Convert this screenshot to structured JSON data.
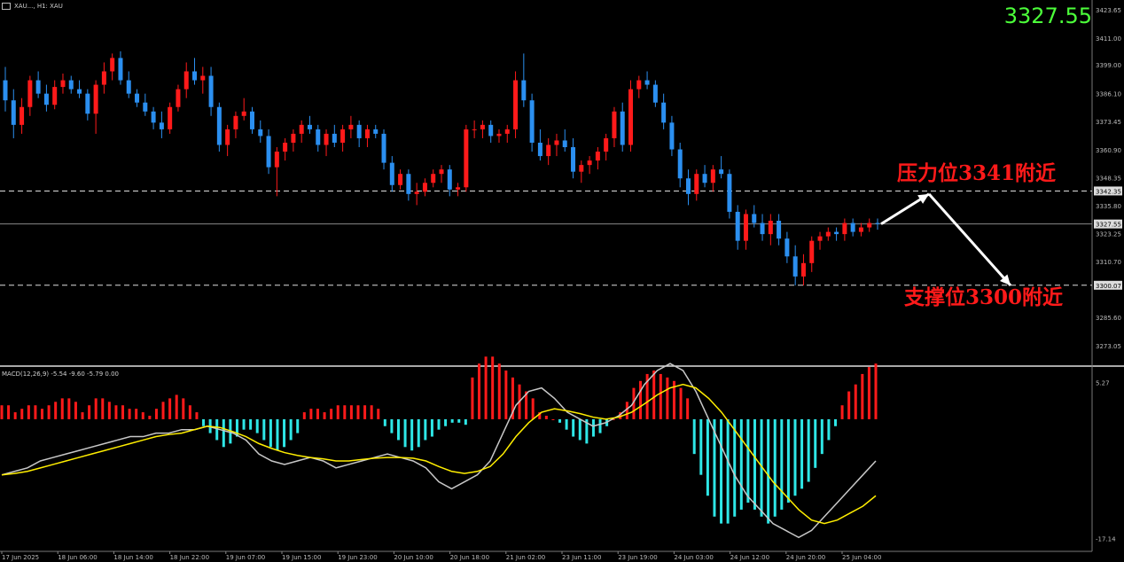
{
  "header": {
    "symbol_text": "XAU..., H1: XAU"
  },
  "current_price": "3327.55",
  "annotations": {
    "resistance": "压力位3341附近",
    "support": "支撑位3300附近"
  },
  "macd": {
    "label": "MACD(12,26,9) -5.54 -9.60 -5.79 0.00"
  },
  "colors": {
    "bull": "#ff1a1a",
    "bear": "#2b8ff0",
    "hist_pos": "#ff1a1a",
    "hist_neg": "#2ee6e6",
    "macd_line": "#c8c8c8",
    "signal_line": "#ffee00",
    "price_tag": "#4cff3a"
  },
  "chart_data": [
    {
      "type": "candlestick",
      "y_ticks": [
        "3423.65",
        "3411.00",
        "3399.00",
        "3386.10",
        "3373.45",
        "3360.90",
        "3348.35",
        "3342.35",
        "3335.80",
        "3327.55",
        "3323.25",
        "3310.70",
        "3300.07",
        "3285.60",
        "3273.05"
      ],
      "x_ticks": [
        "17 Jun 2025",
        "18 Jun 06:00",
        "18 Jun 14:00",
        "18 Jun 22:00",
        "19 Jun 07:00",
        "19 Jun 15:00",
        "19 Jun 23:00",
        "20 Jun 10:00",
        "20 Jun 18:00",
        "21 Jun 02:00",
        "23 Jun 11:00",
        "23 Jun 19:00",
        "24 Jun 03:00",
        "24 Jun 12:00",
        "24 Jun 20:00",
        "25 Jun 04:00"
      ],
      "ylim": [
        3265,
        3428
      ],
      "hlines": [
        3342.35,
        3327.55,
        3300.07
      ],
      "candles": [
        [
          3392,
          3398,
          3378,
          3383
        ],
        [
          3383,
          3388,
          3366,
          3372
        ],
        [
          3372,
          3384,
          3368,
          3380
        ],
        [
          3380,
          3394,
          3376,
          3392
        ],
        [
          3392,
          3396,
          3384,
          3386
        ],
        [
          3386,
          3390,
          3378,
          3381
        ],
        [
          3381,
          3392,
          3379,
          3389
        ],
        [
          3389,
          3395,
          3386,
          3392
        ],
        [
          3392,
          3394,
          3386,
          3388
        ],
        [
          3388,
          3392,
          3384,
          3386
        ],
        [
          3386,
          3388,
          3374,
          3377
        ],
        [
          3377,
          3392,
          3368,
          3390
        ],
        [
          3390,
          3400,
          3386,
          3396
        ],
        [
          3396,
          3404,
          3392,
          3402
        ],
        [
          3402,
          3405,
          3390,
          3392
        ],
        [
          3392,
          3396,
          3384,
          3386
        ],
        [
          3386,
          3388,
          3380,
          3382
        ],
        [
          3382,
          3386,
          3376,
          3378
        ],
        [
          3378,
          3380,
          3370,
          3373
        ],
        [
          3373,
          3378,
          3366,
          3370
        ],
        [
          3370,
          3382,
          3368,
          3380
        ],
        [
          3380,
          3390,
          3378,
          3388
        ],
        [
          3388,
          3400,
          3384,
          3396
        ],
        [
          3396,
          3402,
          3390,
          3392
        ],
        [
          3392,
          3398,
          3386,
          3394
        ],
        [
          3394,
          3398,
          3376,
          3380
        ],
        [
          3380,
          3382,
          3360,
          3363
        ],
        [
          3363,
          3372,
          3358,
          3370
        ],
        [
          3370,
          3378,
          3366,
          3376
        ],
        [
          3376,
          3384,
          3374,
          3378
        ],
        [
          3378,
          3380,
          3368,
          3370
        ],
        [
          3370,
          3374,
          3364,
          3367
        ],
        [
          3367,
          3370,
          3350,
          3353
        ],
        [
          3353,
          3362,
          3340,
          3360
        ],
        [
          3360,
          3366,
          3356,
          3364
        ],
        [
          3364,
          3370,
          3360,
          3368
        ],
        [
          3368,
          3374,
          3364,
          3372
        ],
        [
          3372,
          3376,
          3368,
          3370
        ],
        [
          3370,
          3372,
          3360,
          3363
        ],
        [
          3363,
          3370,
          3358,
          3368
        ],
        [
          3368,
          3372,
          3362,
          3364
        ],
        [
          3364,
          3372,
          3360,
          3370
        ],
        [
          3370,
          3376,
          3366,
          3372
        ],
        [
          3372,
          3374,
          3362,
          3366
        ],
        [
          3366,
          3372,
          3362,
          3370
        ],
        [
          3370,
          3372,
          3366,
          3368
        ],
        [
          3368,
          3370,
          3352,
          3355
        ],
        [
          3355,
          3358,
          3342,
          3345
        ],
        [
          3345,
          3352,
          3343,
          3350
        ],
        [
          3350,
          3352,
          3338,
          3341
        ],
        [
          3341,
          3346,
          3336,
          3342
        ],
        [
          3342,
          3348,
          3340,
          3346
        ],
        [
          3346,
          3352,
          3344,
          3350
        ],
        [
          3350,
          3354,
          3346,
          3352
        ],
        [
          3352,
          3354,
          3340,
          3343
        ],
        [
          3343,
          3346,
          3340,
          3344
        ],
        [
          3344,
          3372,
          3342,
          3370
        ],
        [
          3370,
          3374,
          3366,
          3370
        ],
        [
          3370,
          3374,
          3366,
          3372
        ],
        [
          3372,
          3374,
          3364,
          3367
        ],
        [
          3367,
          3370,
          3364,
          3368
        ],
        [
          3368,
          3372,
          3364,
          3370
        ],
        [
          3370,
          3396,
          3366,
          3392
        ],
        [
          3392,
          3404,
          3380,
          3383
        ],
        [
          3383,
          3386,
          3360,
          3364
        ],
        [
          3364,
          3370,
          3356,
          3358
        ],
        [
          3358,
          3366,
          3354,
          3363
        ],
        [
          3363,
          3368,
          3358,
          3365
        ],
        [
          3365,
          3370,
          3360,
          3362
        ],
        [
          3362,
          3366,
          3348,
          3351
        ],
        [
          3351,
          3356,
          3346,
          3354
        ],
        [
          3354,
          3358,
          3350,
          3356
        ],
        [
          3356,
          3362,
          3352,
          3360
        ],
        [
          3360,
          3368,
          3356,
          3366
        ],
        [
          3366,
          3380,
          3362,
          3378
        ],
        [
          3378,
          3382,
          3360,
          3363
        ],
        [
          3363,
          3392,
          3360,
          3388
        ],
        [
          3388,
          3394,
          3384,
          3392
        ],
        [
          3392,
          3396,
          3388,
          3390
        ],
        [
          3390,
          3392,
          3380,
          3382
        ],
        [
          3382,
          3386,
          3370,
          3373
        ],
        [
          3373,
          3376,
          3358,
          3361
        ],
        [
          3361,
          3364,
          3344,
          3348
        ],
        [
          3348,
          3352,
          3336,
          3341
        ],
        [
          3341,
          3352,
          3338,
          3350
        ],
        [
          3350,
          3354,
          3344,
          3346
        ],
        [
          3346,
          3354,
          3342,
          3352
        ],
        [
          3352,
          3358,
          3348,
          3350
        ],
        [
          3350,
          3352,
          3330,
          3333
        ],
        [
          3333,
          3336,
          3316,
          3320
        ],
        [
          3320,
          3334,
          3316,
          3332
        ],
        [
          3332,
          3336,
          3326,
          3328
        ],
        [
          3328,
          3332,
          3320,
          3323
        ],
        [
          3323,
          3332,
          3318,
          3329
        ],
        [
          3329,
          3332,
          3318,
          3321
        ],
        [
          3321,
          3324,
          3310,
          3313
        ],
        [
          3313,
          3318,
          3300,
          3304
        ],
        [
          3304,
          3314,
          3300,
          3310
        ],
        [
          3310,
          3322,
          3306,
          3320
        ],
        [
          3320,
          3324,
          3316,
          3322
        ],
        [
          3322,
          3326,
          3320,
          3324
        ],
        [
          3324,
          3326,
          3320,
          3323
        ],
        [
          3323,
          3330,
          3320,
          3328
        ],
        [
          3328,
          3330,
          3322,
          3324
        ],
        [
          3324,
          3328,
          3322,
          3326
        ],
        [
          3326,
          3330,
          3324,
          3328
        ],
        [
          3328,
          3330,
          3325,
          3327.55
        ]
      ],
      "forecast_path": [
        [
          3327.55
        ],
        [
          3341
        ],
        [
          3300
        ]
      ]
    },
    {
      "type": "macd",
      "label": "MACD(12,26,9) -5.54 -9.60 -5.79 0.00",
      "y_ticks": [
        "5.27",
        "-17.14"
      ],
      "ylim": [
        -19,
        7
      ],
      "histogram": [
        2,
        2,
        1,
        1.5,
        2,
        2,
        1.5,
        2,
        2.5,
        3,
        3,
        2.5,
        1,
        2,
        3,
        3,
        2.5,
        2,
        2,
        1.5,
        1.5,
        1,
        0.5,
        1.5,
        2.5,
        3,
        3.5,
        3,
        2,
        1,
        -1,
        -2,
        -3,
        -4,
        -3.5,
        -2.5,
        -1.5,
        -1.5,
        -2,
        -3,
        -4,
        -4.5,
        -4,
        -3,
        -2,
        1,
        1.5,
        1.5,
        1,
        1.5,
        2,
        2,
        2,
        2,
        2,
        2,
        1.5,
        -1,
        -2,
        -3,
        -4,
        -4.5,
        -4,
        -3,
        -2.5,
        -1.5,
        -1,
        -0.5,
        -0.5,
        -0.8,
        6,
        8,
        9,
        9,
        8,
        7,
        6,
        5,
        4,
        3,
        1,
        0.5,
        0,
        -0.5,
        -1.5,
        -2.5,
        -3,
        -3.5,
        -2.5,
        -2,
        -1,
        0,
        1,
        2.5,
        4.5,
        5.5,
        6.5,
        7,
        6.5,
        6,
        5.5,
        4.5,
        3,
        -5,
        -8,
        -11,
        -14,
        -15,
        -15,
        -14,
        -13,
        -12,
        -13,
        -14,
        -15,
        -14,
        -13,
        -12,
        -11,
        -10,
        -9,
        -7,
        -5,
        -3,
        -1,
        2,
        4,
        5,
        6.5,
        7.5,
        8
      ],
      "macd_line": [
        -8,
        -7.5,
        -7,
        -6,
        -5.5,
        -5,
        -4.5,
        -4,
        -3.5,
        -3,
        -2.5,
        -2.5,
        -2,
        -2,
        -1.5,
        -1.5,
        -1,
        -1.5,
        -2,
        -3,
        -5,
        -6,
        -6.5,
        -6,
        -5.5,
        -6,
        -7,
        -6.5,
        -6,
        -5.5,
        -5,
        -5.5,
        -6,
        -7,
        -9,
        -10,
        -9,
        -8,
        -6,
        -2,
        2,
        4,
        4.5,
        3,
        1,
        0,
        -1,
        -0.5,
        0.5,
        2,
        5,
        7,
        8,
        7,
        4,
        0,
        -4,
        -8,
        -11,
        -13,
        -15,
        -16,
        -17,
        -16,
        -14,
        -12,
        -10,
        -8,
        -6
      ],
      "signal_line": [
        -8,
        -7.8,
        -7.5,
        -7,
        -6.5,
        -6,
        -5.5,
        -5,
        -4.5,
        -4,
        -3.5,
        -3,
        -2.5,
        -2.2,
        -2,
        -1.5,
        -1,
        -1.2,
        -1.8,
        -2.5,
        -3.5,
        -4.2,
        -4.8,
        -5.2,
        -5.5,
        -5.7,
        -6,
        -6,
        -5.8,
        -5.6,
        -5.5,
        -5.5,
        -5.6,
        -6,
        -6.8,
        -7.5,
        -7.8,
        -7.5,
        -6.8,
        -5,
        -2.5,
        -0.5,
        1,
        1.5,
        1.2,
        0.8,
        0.3,
        0,
        0.3,
        1,
        2.2,
        3.5,
        4.5,
        5,
        4.5,
        3,
        1,
        -1.5,
        -4,
        -6.5,
        -9,
        -11,
        -13,
        -14.5,
        -15,
        -14.5,
        -13.5,
        -12.5,
        -11
      ]
    }
  ]
}
